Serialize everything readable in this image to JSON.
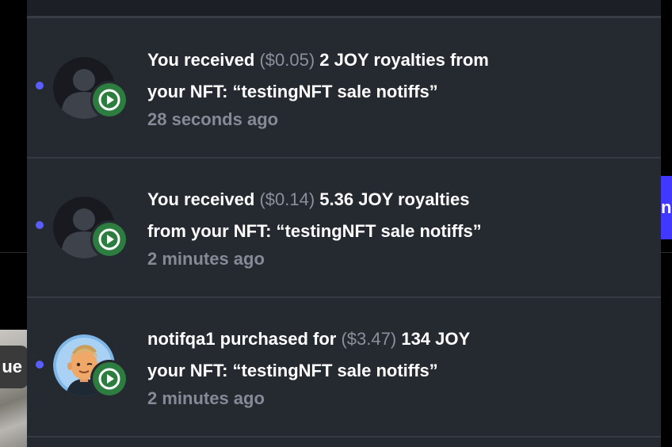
{
  "background": {
    "right_button_label": "nd",
    "left_card_pill_label": "ue"
  },
  "colors": {
    "panel_bg": "#252930",
    "unread_dot": "#5a5dff",
    "badge_green": "#2e7d40",
    "text_primary": "#ffffff",
    "text_secondary": "#858b96"
  },
  "notifications": [
    {
      "lead": "You received",
      "fiat": "($0.05)",
      "body_line1_tail": "2 JOY royalties from",
      "line2": "your NFT: “testingNFT sale notiffs”",
      "time": "28 seconds ago",
      "avatar": "default-user-avatar-icon",
      "badge": "play-badge-icon",
      "unread": true
    },
    {
      "lead": "You received",
      "fiat": "($0.14)",
      "body_line1_tail": "5.36 JOY royalties",
      "line2": "from your NFT: “testingNFT sale notiffs”",
      "time": "2 minutes ago",
      "avatar": "default-user-avatar-icon",
      "badge": "play-badge-icon",
      "unread": true
    },
    {
      "lead": "notifqa1 purchased for",
      "fiat": "($3.47)",
      "body_line1_tail": "134 JOY",
      "line2": "your NFT: “testingNFT sale notiffs”",
      "time": "2 minutes ago",
      "avatar": "cartoon-user-avatar-icon",
      "badge": "play-badge-icon",
      "unread": true
    }
  ]
}
